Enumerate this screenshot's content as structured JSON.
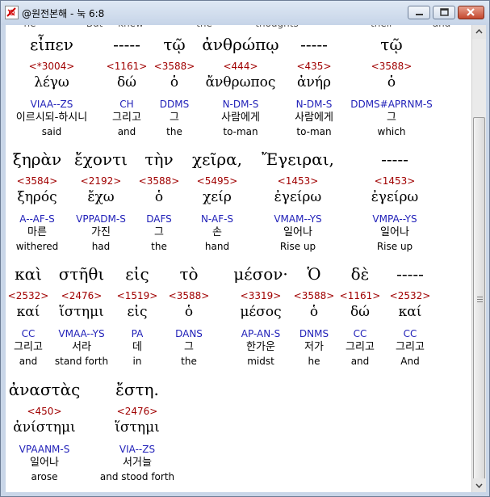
{
  "window": {
    "title": "@원전본해 - 눅 6:8"
  },
  "top_cut": [
    "he",
    "But",
    "knew",
    "the",
    "thoughts",
    "their",
    "and"
  ],
  "rows": [
    [
      {
        "greek": "εἶπεν",
        "strong": "<*3004>",
        "lemma": "λέγω",
        "morph": "VIAA--ZS",
        "korean": "이르시되-하시니",
        "english": "said"
      },
      {
        "greek": "-----",
        "strong": "<1161>",
        "lemma": "δώ",
        "morph": "CH",
        "korean": "그리고",
        "english": "and"
      },
      {
        "greek": "τῷ",
        "strong": "<3588>",
        "lemma": "ὁ",
        "morph": "DDMS",
        "korean": "그",
        "english": "the"
      },
      {
        "greek": "ἀνθρώπῳ",
        "strong": "<444>",
        "lemma": "ἄνθρωπος",
        "morph": "N-DM-S",
        "korean": "사람에게",
        "english": "to-man"
      },
      {
        "greek": "-----",
        "strong": "<435>",
        "lemma": "ἀνήρ",
        "morph": "N-DM-S",
        "korean": "사람에게",
        "english": "to-man"
      },
      {
        "greek": "τῷ",
        "strong": "<3588>",
        "lemma": "ὁ",
        "morph": "DDMS#APRNM-S",
        "korean": "그",
        "english": "which"
      }
    ],
    [
      {
        "greek": "ξηρὰν",
        "strong": "<3584>",
        "lemma": "ξηρός",
        "morph": "A--AF-S",
        "korean": "마른",
        "english": "withered"
      },
      {
        "greek": "ἔχοντι",
        "strong": "<2192>",
        "lemma": "ἔχω",
        "morph": "VPPADM-S",
        "korean": "가진",
        "english": "had"
      },
      {
        "greek": "τὴν",
        "strong": "<3588>",
        "lemma": "ὁ",
        "morph": "DAFS",
        "korean": "그",
        "english": "the"
      },
      {
        "greek": "χεῖρα,",
        "strong": "<5495>",
        "lemma": "χείρ",
        "morph": "N-AF-S",
        "korean": "손",
        "english": "hand"
      },
      {
        "greek": "Ἔγειραι,",
        "strong": "<1453>",
        "lemma": "ἐγείρω",
        "morph": "VMAM--YS",
        "korean": "일어나",
        "english": "Rise up"
      },
      {
        "greek": "-----",
        "strong": "<1453>",
        "lemma": "ἐγείρω",
        "morph": "VMPA--YS",
        "korean": "일어나",
        "english": "Rise up"
      }
    ],
    [
      {
        "greek": "καὶ",
        "strong": "<2532>",
        "lemma": "καί",
        "morph": "CC",
        "korean": "그리고",
        "english": "and"
      },
      {
        "greek": "στῆθι",
        "strong": "<2476>",
        "lemma": "ἵστημι",
        "morph": "VMAA--YS",
        "korean": "서라",
        "english": "stand forth"
      },
      {
        "greek": "εἰς",
        "strong": "<1519>",
        "lemma": "εἰς",
        "morph": "PA",
        "korean": "데",
        "english": "in"
      },
      {
        "greek": "τὸ",
        "strong": "<3588>",
        "lemma": "ὁ",
        "morph": "DANS",
        "korean": "그",
        "english": "the"
      },
      {
        "greek": "μέσον·",
        "strong": "<3319>",
        "lemma": "μέσος",
        "morph": "AP-AN-S",
        "korean": "한가운",
        "english": "midst"
      },
      {
        "greek": "Ὁ",
        "strong": "<3588>",
        "lemma": "ὁ",
        "morph": "DNMS",
        "korean": "저가",
        "english": "he"
      },
      {
        "greek": "δὲ",
        "strong": "<1161>",
        "lemma": "δώ",
        "morph": "CC",
        "korean": "그리고",
        "english": "and"
      },
      {
        "greek": "-----",
        "strong": "<2532>",
        "lemma": "καί",
        "morph": "CC",
        "korean": "그리고",
        "english": "And"
      }
    ],
    [
      {
        "greek": "ἀναστὰς",
        "strong": "<450>",
        "lemma": "ἀνίστημι",
        "morph": "VPAANM-S",
        "korean": "일어나",
        "english": "arose"
      },
      {
        "greek": "ἔστη.",
        "strong": "<2476>",
        "lemma": "ἵστημι",
        "morph": "VIA--ZS",
        "korean": "서거늘",
        "english": "and stood forth"
      }
    ]
  ]
}
